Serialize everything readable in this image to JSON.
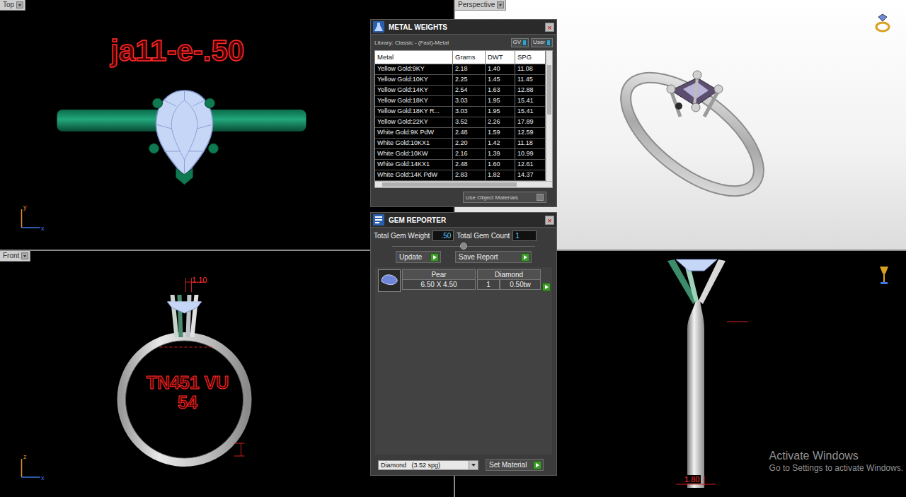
{
  "viewports": {
    "top": {
      "label": "Top",
      "caption": "ja11-e-.50",
      "axes": [
        "y",
        "x"
      ]
    },
    "perspective": {
      "label": "Perspective"
    },
    "front": {
      "label": "Front",
      "caption": [
        "TN451 VU",
        "54"
      ],
      "dimension": "1.10",
      "axes": [
        "z",
        "x"
      ]
    },
    "side": {
      "dimension": "1.80"
    }
  },
  "metal_weights": {
    "title": "METAL WEIGHTS",
    "close": "×",
    "library": "Library: Classic - (Fast)-Metal",
    "toggles": [
      "GV",
      "User"
    ],
    "columns": [
      "Metal",
      "Grams",
      "DWT",
      "SPG"
    ],
    "rows": [
      [
        "Yellow Gold:9KY",
        "2.18",
        "1.40",
        "11.08"
      ],
      [
        "Yellow Gold:10KY",
        "2.25",
        "1.45",
        "11.45"
      ],
      [
        "Yellow Gold:14KY",
        "2.54",
        "1.63",
        "12.88"
      ],
      [
        "Yellow Gold:18KY",
        "3.03",
        "1.95",
        "15.41"
      ],
      [
        "Yellow Gold:18KY R...",
        "3.03",
        "1.95",
        "15.41"
      ],
      [
        "Yellow Gold:22KY",
        "3.52",
        "2.26",
        "17.89"
      ],
      [
        "White Gold:9K PdW",
        "2.48",
        "1.59",
        "12.59"
      ],
      [
        "White Gold:10KX1",
        "2.20",
        "1.42",
        "11.18"
      ],
      [
        "White Gold:10KW",
        "2.16",
        "1.39",
        "10.99"
      ],
      [
        "White Gold:14KX1",
        "2.48",
        "1.60",
        "12.61"
      ],
      [
        "White Gold:14K PdW",
        "2.83",
        "1.82",
        "14.37"
      ]
    ],
    "footer": "Use Object Materials"
  },
  "gem_reporter": {
    "title": "GEM REPORTER",
    "close": "×",
    "total_weight_label": "Total Gem Weight",
    "total_weight": ".50",
    "total_count_label": "Total Gem Count",
    "total_count": "1",
    "buttons": [
      "Update",
      "Save Report"
    ],
    "gems": [
      {
        "shape": "Pear",
        "size": "6.50 X 4.50",
        "material": "Diamond",
        "count": "1",
        "weight": "0.50tw"
      }
    ],
    "material_select": "Diamond   (3.52 spg)",
    "set_button": "Set Material"
  },
  "watermark": {
    "title": "Activate Windows",
    "subtitle": "Go to Settings to activate Windows."
  }
}
